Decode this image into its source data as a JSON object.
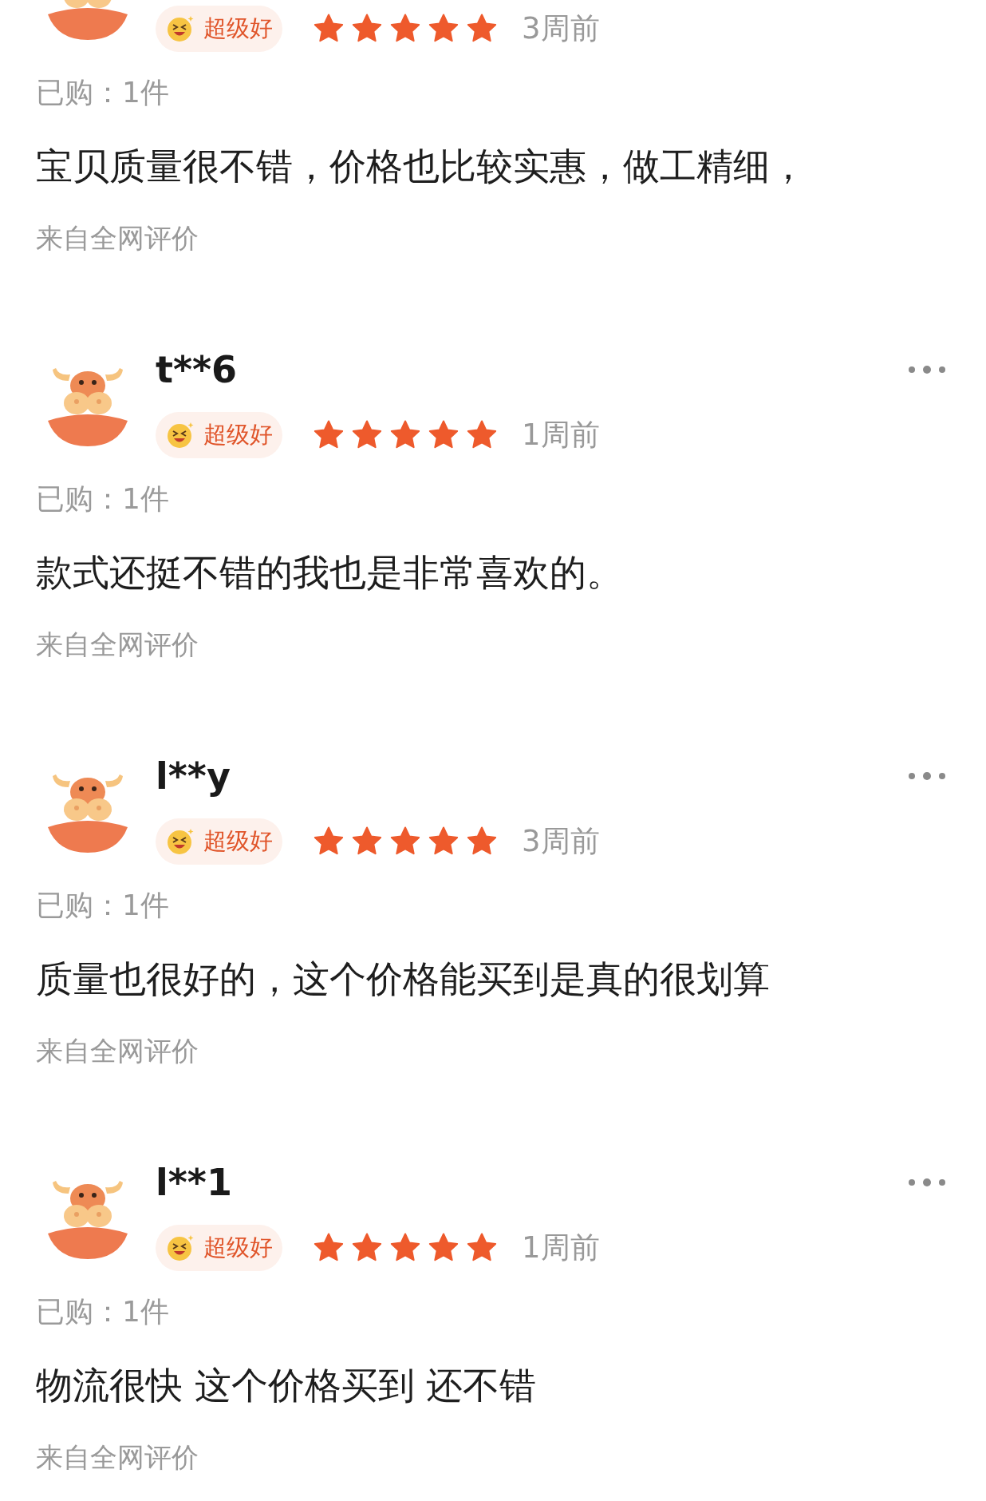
{
  "reviews": [
    {
      "badge": "超级好",
      "stars": 5,
      "time": "3周前",
      "purchased": "已购：1件",
      "content": "宝贝质量很不错，价格也比较实惠，做工精细，",
      "source": "来自全网评价"
    },
    {
      "name": "t**6",
      "badge": "超级好",
      "stars": 5,
      "time": "1周前",
      "purchased": "已购：1件",
      "content": "款式还挺不错的我也是非常喜欢的。",
      "source": "来自全网评价"
    },
    {
      "name": "l**y",
      "badge": "超级好",
      "stars": 5,
      "time": "3周前",
      "purchased": "已购：1件",
      "content": "质量也很好的，这个价格能买到是真的很划算",
      "source": "来自全网评价"
    },
    {
      "name": "l**1",
      "badge": "超级好",
      "stars": 5,
      "time": "1周前",
      "purchased": "已购：1件",
      "content": "物流很快 这个价格买到 还不错",
      "source": "来自全网评价"
    }
  ]
}
